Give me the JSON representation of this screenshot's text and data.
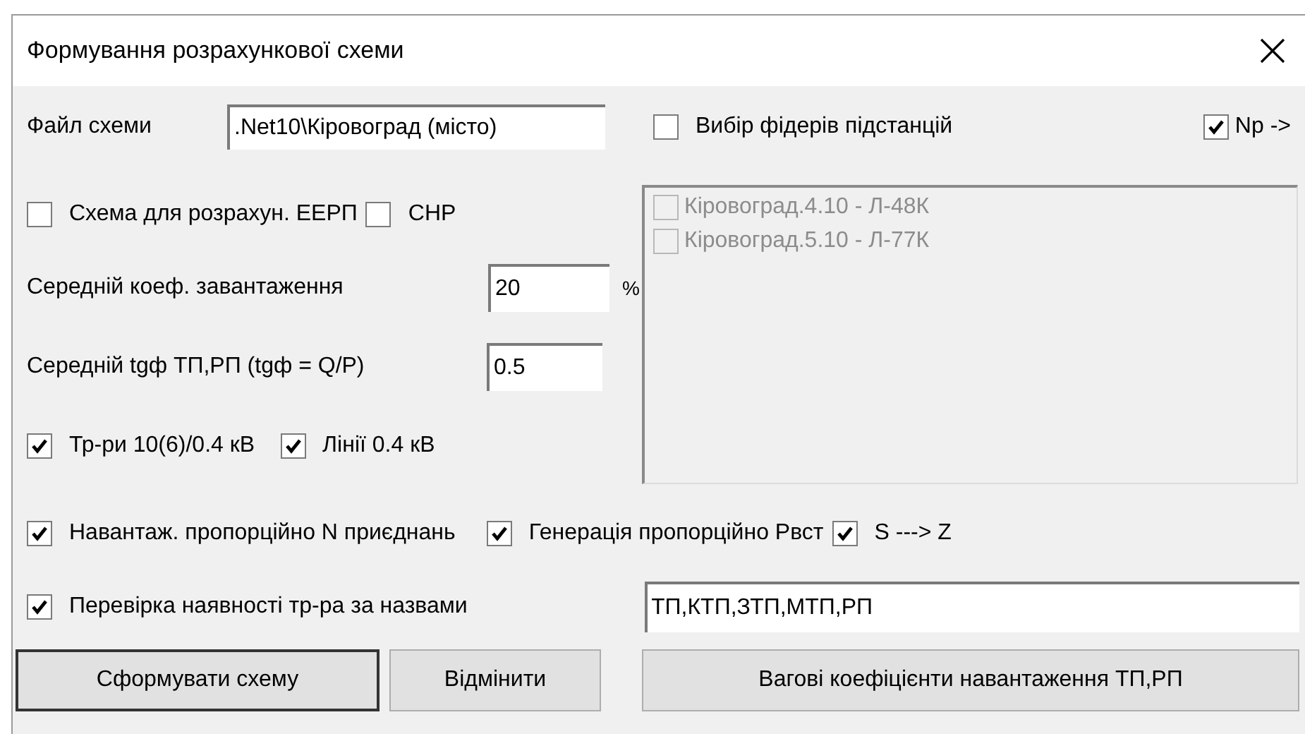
{
  "window": {
    "title": "Формування розрахункової схеми"
  },
  "file_field": {
    "label": "Файл схеми",
    "value": ".Net10\\Кіровоград (місто)"
  },
  "feeder_selection": {
    "label": "Вибір фідерів підстанцій",
    "checked": false
  },
  "np_option": {
    "label": "Np ->",
    "checked": true
  },
  "scheme_options": [
    {
      "label": "Схема для розрахун. ЕЕРП",
      "checked": false
    },
    {
      "label": "СНР",
      "checked": false
    }
  ],
  "load_coefficient": {
    "label": "Середній коеф. завантаження",
    "value": "20",
    "unit": "%"
  },
  "tg_field": {
    "label": "Середній tgф ТП,РП (tgф = Q/P)",
    "value": "0.5"
  },
  "element_options": [
    {
      "label": "Тр-ри 10(6)/0.4 кВ",
      "checked": true
    },
    {
      "label": "Лінії 0.4 кВ",
      "checked": true
    }
  ],
  "feeders": {
    "disabled": true,
    "items": [
      {
        "label": "Кіровоград.4.10 - Л-48К",
        "checked": false
      },
      {
        "label": "Кіровоград.5.10 - Л-77К",
        "checked": false
      }
    ]
  },
  "proportional_options": [
    {
      "label": "Навантаж. пропорційно N приєднань",
      "checked": true
    },
    {
      "label": "Генерація пропорційно Рвст",
      "checked": true
    },
    {
      "label": "S ---> Z",
      "checked": true
    }
  ],
  "name_check": {
    "label": "Перевірка наявності тр-ра за назвами",
    "checked": true,
    "value": "ТП,КТП,ЗТП,МТП,РП"
  },
  "buttons": [
    {
      "label": "Сформувати схему",
      "default": true
    },
    {
      "label": "Відмінити",
      "default": false
    },
    {
      "label": "Вагові коефіцієнти навантаження ТП,РП",
      "default": false
    }
  ]
}
